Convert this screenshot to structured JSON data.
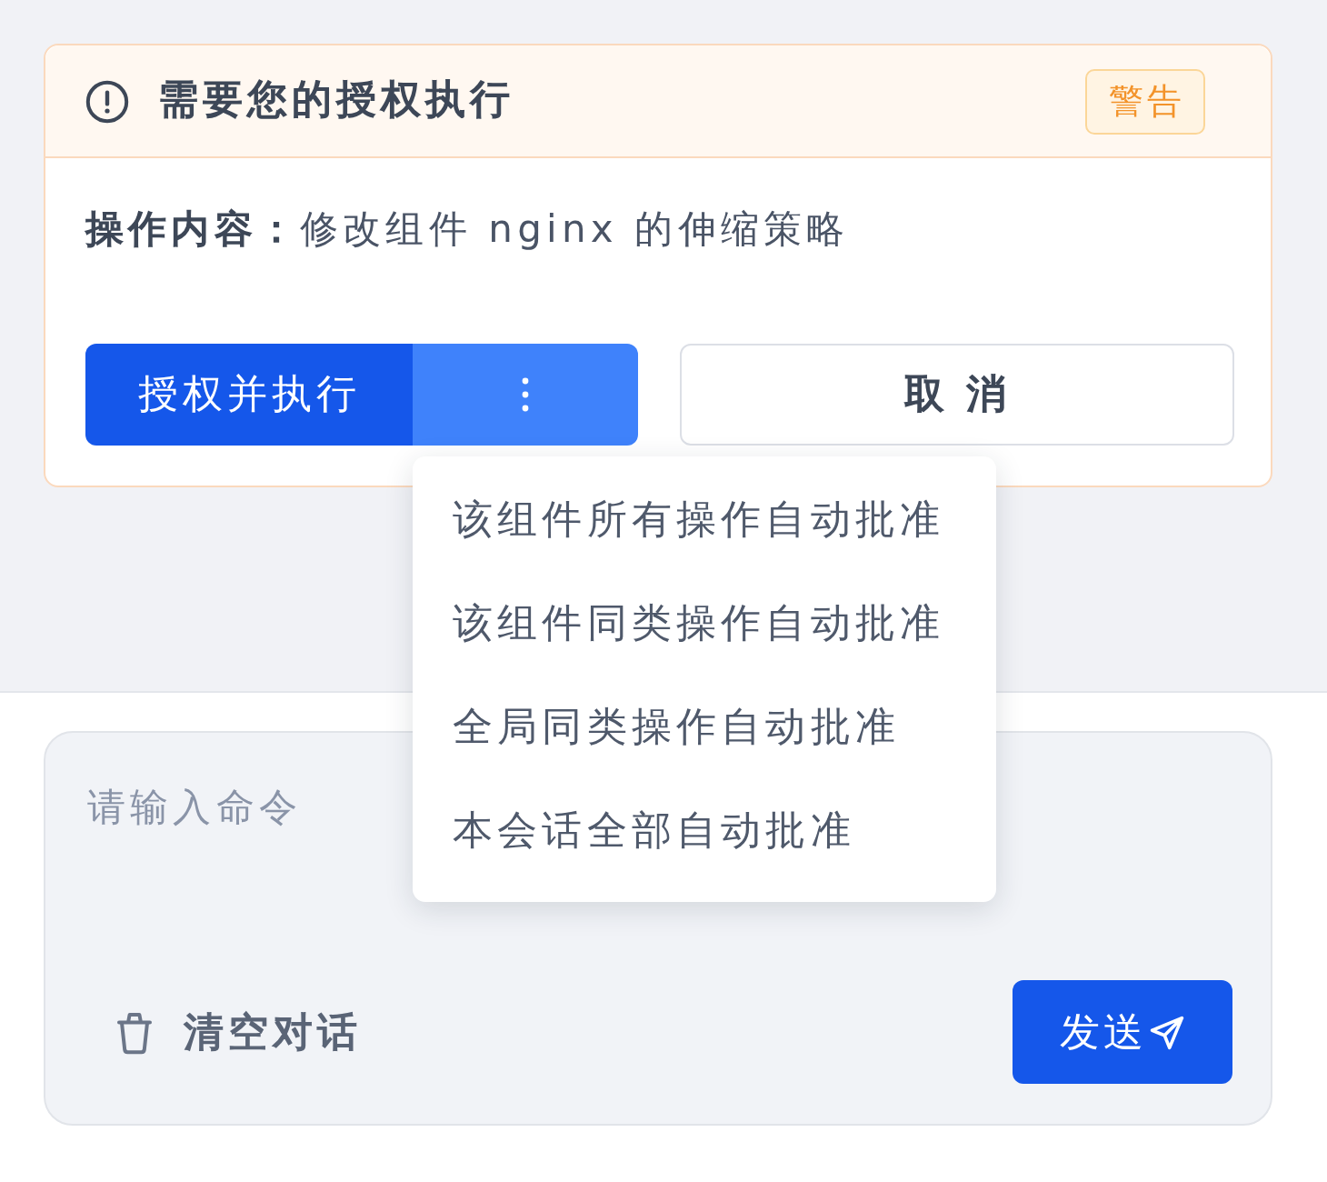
{
  "alert": {
    "kind": "warning",
    "title": "需要您的授权执行",
    "badge": "警告",
    "content": "**操作内容：**修改组件 nginx 的伸缩策略",
    "actions": {
      "approve": "授权并执行",
      "cancel": "取 消",
      "menu": {
        "open": true,
        "items": [
          "该组件所有操作自动批准",
          "该组件同类操作自动批准",
          "全局同类操作自动批准",
          "本会话全部自动批准"
        ]
      }
    }
  },
  "composer": {
    "placeholder": "请输入命令",
    "clear_button": "清空对话",
    "send_button": "发送"
  }
}
